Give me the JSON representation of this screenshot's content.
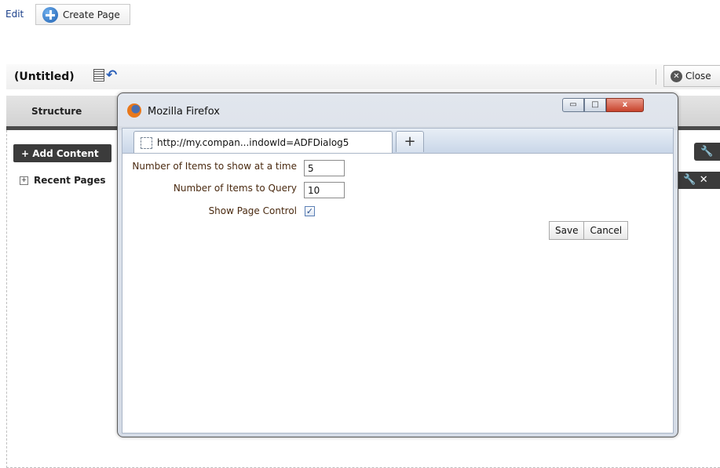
{
  "toolbar": {
    "edit_label": "Edit",
    "create_page_label": "Create Page"
  },
  "page": {
    "title": "(Untitled)",
    "close_label": "Close"
  },
  "structure": {
    "label": "Structure"
  },
  "content": {
    "add_content_label": "+ Add Content",
    "recent_pages_label": "Recent Pages",
    "expand_glyph": "+"
  },
  "icons": {
    "wrench": "wrench-icon",
    "wrench_glyph": "🔧",
    "x_glyph": "✕",
    "close_glyph": "✕",
    "undo_glyph": "↶"
  },
  "firefox": {
    "window_title": "Mozilla Firefox",
    "window_controls": {
      "minimize": "▭",
      "restore": "□",
      "close": "x"
    },
    "tab_url": "http://my.compan...indowId=ADFDialog5",
    "new_tab_label": "+"
  },
  "form": {
    "items_per_page_label": "Number of Items to show at a time",
    "items_per_page_value": "5",
    "items_query_label": "Number of Items to Query",
    "items_query_value": "10",
    "show_page_control_label": "Show Page Control",
    "show_page_control_checked": true,
    "check_glyph": "✓",
    "save_label": "Save",
    "cancel_label": "Cancel"
  }
}
